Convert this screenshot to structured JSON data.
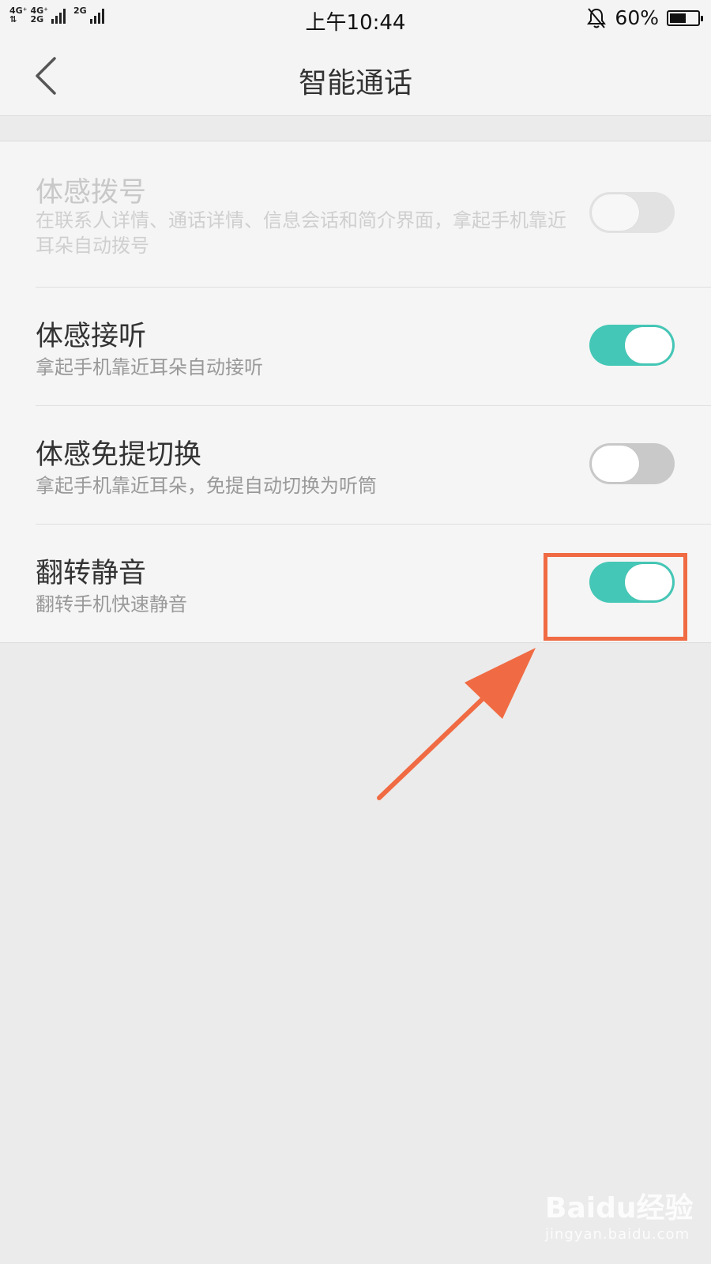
{
  "status_bar": {
    "net1_top": "4G⁺",
    "net1_bottom": "⇅",
    "net2_top": "4G⁺",
    "net2_bottom": "2G",
    "net3_top": "2G",
    "time": "上午10:44",
    "battery_percent": "60%",
    "battery_level": 0.6,
    "icons": [
      "bell-mute-icon",
      "battery-icon",
      "signal-icon"
    ]
  },
  "header": {
    "back_icon": "chevron-left-icon",
    "title": "智能通话"
  },
  "settings": [
    {
      "title": "体感拨号",
      "subtitle": "在联系人详情、通话详情、信息会话和简介界面，拿起手机靠近耳朵自动拨号",
      "state": "off",
      "enabled": false
    },
    {
      "title": "体感接听",
      "subtitle": "拿起手机靠近耳朵自动接听",
      "state": "on",
      "enabled": true
    },
    {
      "title": "体感免提切换",
      "subtitle": "拿起手机靠近耳朵，免提自动切换为听筒",
      "state": "off",
      "enabled": true
    },
    {
      "title": "翻转静音",
      "subtitle": "翻转手机快速静音",
      "state": "on",
      "enabled": true
    }
  ],
  "colors": {
    "toggle_on": "#44c7b6",
    "toggle_off": "#c9c9c9",
    "annotation": "#f06b43"
  },
  "watermark": {
    "logo": "Baidu经验",
    "url": "jingyan.baidu.com"
  }
}
